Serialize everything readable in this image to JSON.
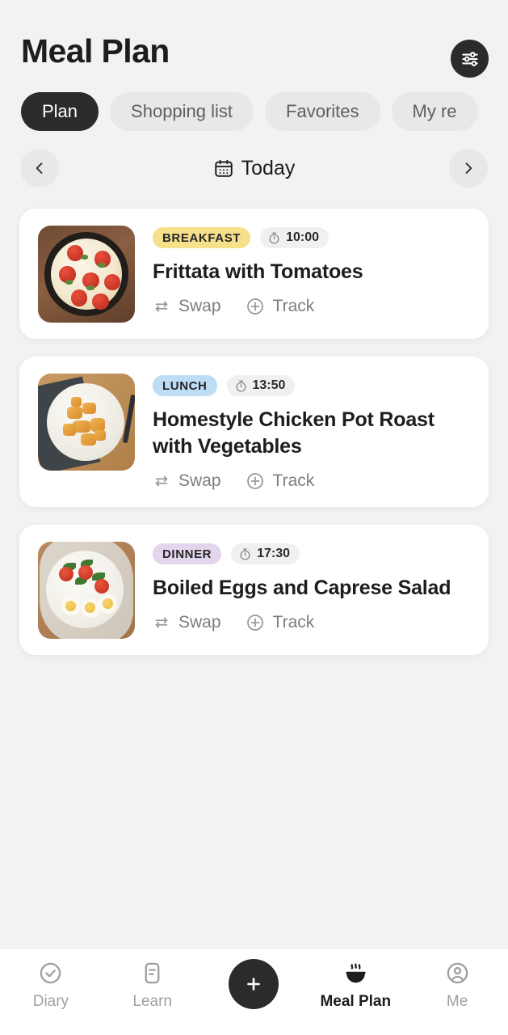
{
  "header": {
    "title": "Meal Plan",
    "settings_icon": "sliders-icon"
  },
  "tabs": [
    {
      "label": "Plan",
      "active": true
    },
    {
      "label": "Shopping list",
      "active": false
    },
    {
      "label": "Favorites",
      "active": false
    },
    {
      "label": "My re",
      "active": false
    }
  ],
  "date_nav": {
    "prev_icon": "chevron-left-icon",
    "next_icon": "chevron-right-icon",
    "calendar_icon": "calendar-icon",
    "label": "Today"
  },
  "actions": {
    "swap_label": "Swap",
    "track_label": "Track",
    "swap_icon": "swap-arrows-icon",
    "track_icon": "plus-circle-icon",
    "timer_icon": "stopwatch-icon"
  },
  "meals": [
    {
      "badge": "BREAKFAST",
      "badge_color": "#f7e08a",
      "time": "10:00",
      "title": "Frittata with Tomatoes",
      "image": "frittata-skillet-photo"
    },
    {
      "badge": "LUNCH",
      "badge_color": "#bdddf5",
      "time": "13:50",
      "title": "Homestyle Chicken Pot Roast with Vegetables",
      "image": "pot-roast-plate-photo"
    },
    {
      "badge": "DINNER",
      "badge_color": "#e2d5ec",
      "time": "17:30",
      "title": "Boiled Eggs and Caprese Salad",
      "image": "caprese-salad-photo"
    }
  ],
  "bottom_nav": [
    {
      "label": "Diary",
      "icon": "check-circle-icon",
      "active": false
    },
    {
      "label": "Learn",
      "icon": "document-icon",
      "active": false
    },
    {
      "label": "",
      "icon": "plus-icon",
      "active": false
    },
    {
      "label": "Meal Plan",
      "icon": "steaming-bowl-icon",
      "active": true
    },
    {
      "label": "Me",
      "icon": "person-circle-icon",
      "active": false
    }
  ],
  "colors": {
    "background": "#f2f2f2",
    "card": "#ffffff",
    "accent_dark": "#2b2b2b",
    "muted_text": "#7d7d7d"
  }
}
